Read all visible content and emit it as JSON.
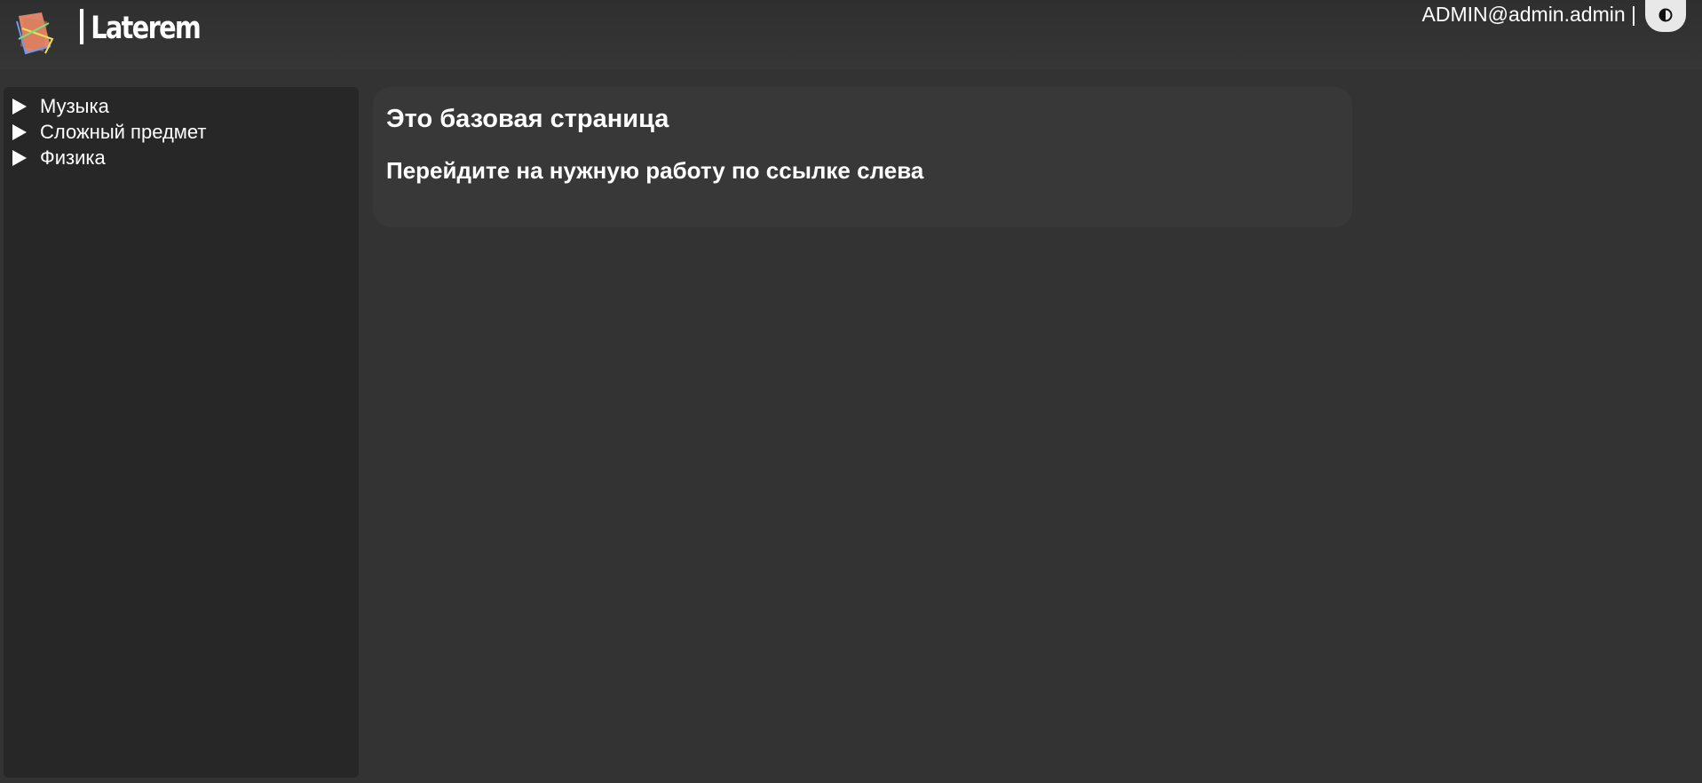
{
  "header": {
    "brand": "Laterem",
    "user_label": "ADMIN@admin.admin |",
    "theme_toggle_icon": "half-circle-contrast-icon",
    "logo_icon": "laterem-logo-icon"
  },
  "sidebar": {
    "items": [
      {
        "label": "Музыка",
        "icon": "triangle-right-icon"
      },
      {
        "label": "Сложный предмет",
        "icon": "triangle-right-icon"
      },
      {
        "label": "Физика",
        "icon": "triangle-right-icon"
      }
    ]
  },
  "main": {
    "title": "Это базовая страница",
    "subtitle": "Перейдите на нужную работу по ссылке слева"
  },
  "colors": {
    "background": "#333333",
    "sidebar": "#272727",
    "card": "#383838",
    "toggle": "#e8e8e8"
  }
}
